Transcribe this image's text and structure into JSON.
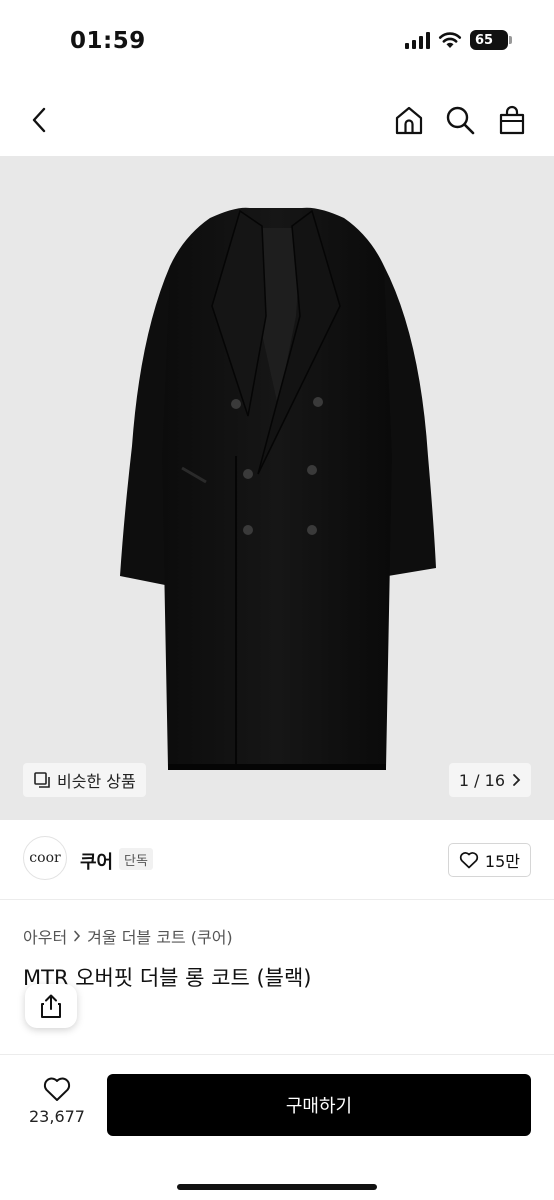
{
  "status_bar": {
    "time": "01:59",
    "battery": "65",
    "icons": [
      "signal-icon",
      "wifi-icon",
      "battery-icon"
    ]
  },
  "nav": {
    "icons": [
      "back-icon",
      "home-icon",
      "search-icon",
      "cart-bag-icon"
    ]
  },
  "hero": {
    "similar_label": "비슷한 상품",
    "page_indicator": "1 / 16",
    "background": "#e7e7e7"
  },
  "brand": {
    "logo_text": "coor",
    "name": "쿠어",
    "badge": "단독",
    "likes": "15만"
  },
  "breadcrumb": {
    "category": "아우터",
    "subcategory": "겨울 더블 코트 (쿠어)"
  },
  "product": {
    "title": "MTR 오버핏 더블 롱 코트 (블랙)"
  },
  "bottom_bar": {
    "wish_count": "23,677",
    "buy_label": "구매하기",
    "buy_color": "#000000"
  }
}
